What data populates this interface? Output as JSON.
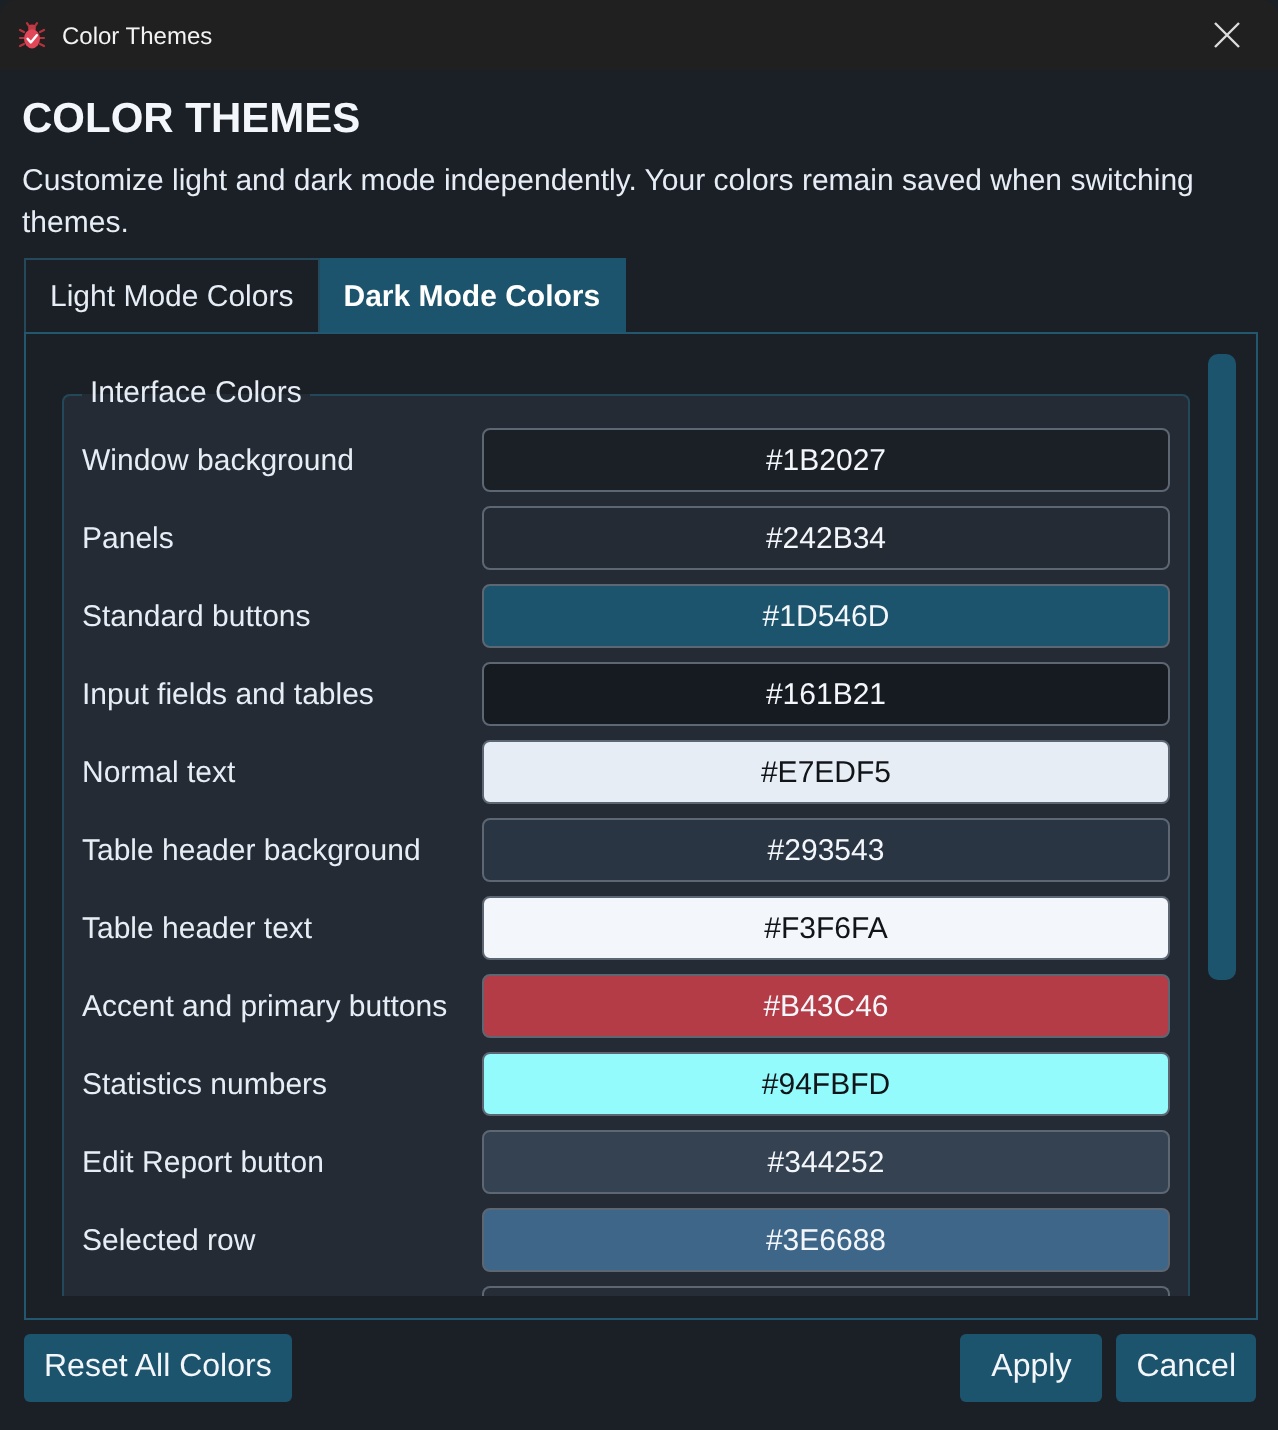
{
  "window": {
    "title": "Color Themes"
  },
  "heading": "COLOR THEMES",
  "description": "Customize light and dark mode independently. Your colors remain saved when switching themes.",
  "tabs": [
    {
      "label": "Light Mode Colors",
      "selected": false
    },
    {
      "label": "Dark Mode Colors",
      "selected": true
    }
  ],
  "group": {
    "title": "Interface Colors",
    "rows": [
      {
        "kind": "color",
        "label": "Window background",
        "value": "#1B2027",
        "color": "#1b2027"
      },
      {
        "kind": "color",
        "label": "Panels",
        "value": "#242B34",
        "color": "#242b34"
      },
      {
        "kind": "color",
        "label": "Standard buttons",
        "value": "#1D546D",
        "color": "#1d546d"
      },
      {
        "kind": "color",
        "label": "Input fields and tables",
        "value": "#161B21",
        "color": "#161b21"
      },
      {
        "kind": "color",
        "label": "Normal text",
        "value": "#E7EDF5",
        "color": "#e7edf5"
      },
      {
        "kind": "color",
        "label": "Table header background",
        "value": "#293543",
        "color": "#293543"
      },
      {
        "kind": "color",
        "label": "Table header text",
        "value": "#F3F6FA",
        "color": "#f3f6fa"
      },
      {
        "kind": "color",
        "label": "Accent and primary buttons",
        "value": "#B43C46",
        "color": "#b43c46"
      },
      {
        "kind": "color",
        "label": "Statistics numbers",
        "value": "#94FBFD",
        "color": "#94fbfd"
      },
      {
        "kind": "color",
        "label": "Edit Report button",
        "value": "#344252",
        "color": "#344252"
      },
      {
        "kind": "color",
        "label": "Selected row",
        "value": "#3E6688",
        "color": "#3e6688"
      },
      {
        "kind": "clipped"
      }
    ]
  },
  "footer": {
    "reset_button": "Reset All Colors",
    "apply_button": "Apply",
    "cancel_button": "Cancel"
  }
}
